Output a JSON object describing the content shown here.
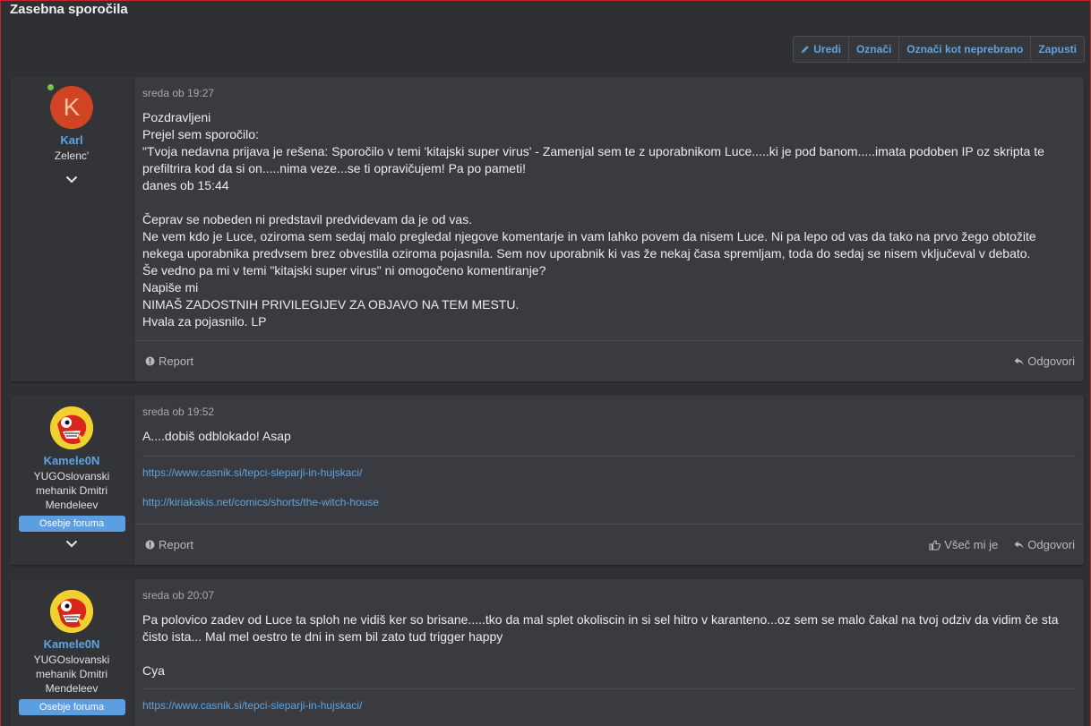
{
  "page": {
    "title": "Zasebna sporočila"
  },
  "toolbar": {
    "edit": "Uredi",
    "mark": "Označi",
    "mark_unread": "Označi kot neprebrano",
    "leave": "Zapusti"
  },
  "messages": [
    {
      "user": {
        "name": "Karl",
        "title": "Zelenc'",
        "avatar_letter": "K",
        "online": true
      },
      "date": "sreda ob 19:27",
      "lines": [
        "Pozdravljeni",
        "Prejel sem sporočilo:",
        "\"Tvoja nedavna prijava je rešena: Sporočilo v temi 'kitajski super virus' - Zamenjal sem te z uporabnikom Luce.....ki je pod banom.....imata podoben IP oz skripta te prefiltrira kod da si on.....nima veze...se ti opravičujem! Pa po pameti!",
        "danes ob 15:44",
        "",
        "Čeprav se nobeden ni predstavil predvidevam da je od vas.",
        "Ne vem kdo je Luce, oziroma sem sedaj malo pregledal njegove komentarje in vam lahko povem da nisem Luce. Ni pa lepo od vas da tako na prvo žego obtožite nekega uporabnika predvsem brez obvestila oziroma pojasnila. Sem nov uporabnik ki vas že nekaj časa spremljam, toda do sedaj se nisem vključeval v debato.",
        "Še vedno pa mi v temi \"kitajski super virus\" ni omogočeno komentiranje?",
        "Napiše mi",
        "NIMAŠ ZADOSTNIH PRIVILEGIJEV ZA OBJAVO NA TEM MESTU.",
        "Hvala za pojasnilo. LP"
      ],
      "footer": {
        "report": "Report",
        "reply": "Odgovori"
      }
    },
    {
      "user": {
        "name": "Kamele0N",
        "title": "YUGOslovanski mehanik Dmitri Mendeleev",
        "badge": "Osebje foruma"
      },
      "date": "sreda ob 19:52",
      "lines": [
        "A....dobiš odblokado! Asap"
      ],
      "signature": [
        "https://www.casnik.si/tepci-sleparji-in-hujskaci/",
        "http://kiriakakis.net/comics/shorts/the-witch-house"
      ],
      "footer": {
        "report": "Report",
        "like": "Všeč mi je",
        "reply": "Odgovori"
      }
    },
    {
      "user": {
        "name": "Kamele0N",
        "title": "YUGOslovanski mehanik Dmitri Mendeleev",
        "badge": "Osebje foruma"
      },
      "date": "sreda ob 20:07",
      "lines": [
        "Pa polovico zadev od Luce ta sploh ne vidiš ker so brisane.....tko da mal splet okoliscin in si sel hitro v karanteno...oz sem se malo čakal na tvoj odziv da vidim če sta čisto ista... Mal mel oestro te dni in sem bil zato tud trigger happy",
        "",
        "Cya"
      ],
      "signature": [
        "https://www.casnik.si/tepci-sleparji-in-hujskaci/"
      ]
    }
  ]
}
